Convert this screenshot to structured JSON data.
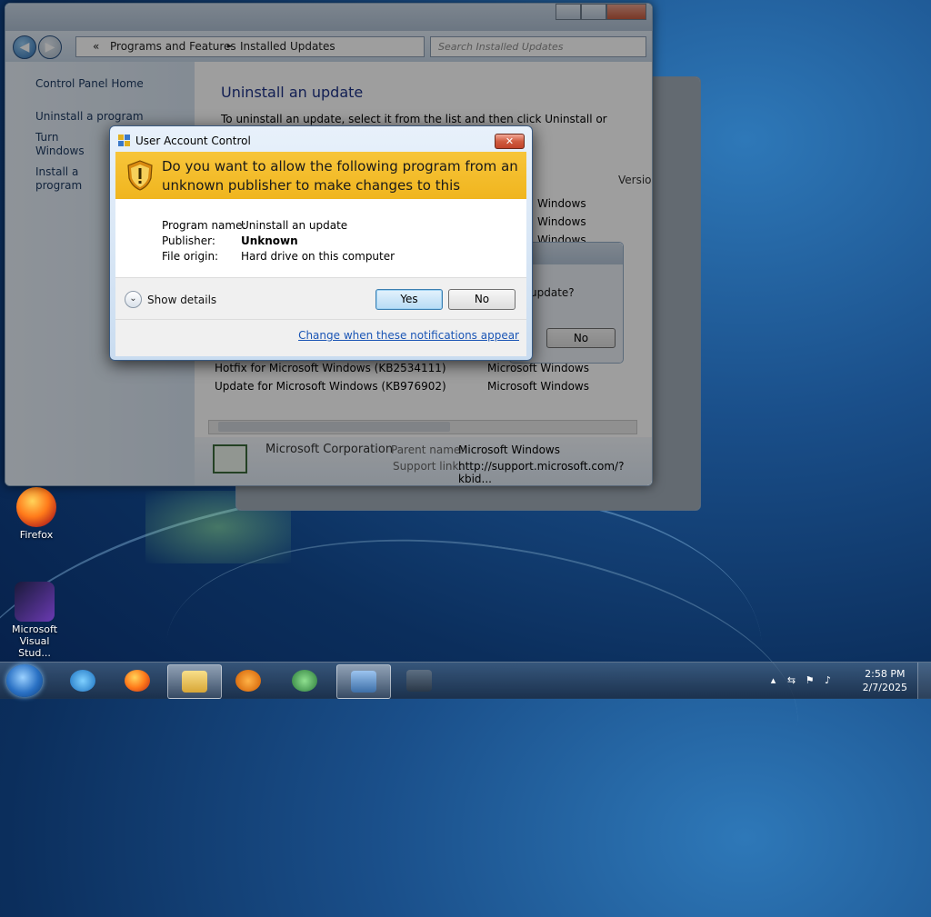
{
  "explorer": {
    "breadcrumb": [
      "«",
      "Programs and Features",
      "►",
      "Installed Updates"
    ],
    "search_placeholder": "Search Installed Updates",
    "left_links": [
      "Control Panel Home",
      "Uninstall a program",
      "Turn Windows features on or off",
      "Install a program from the network"
    ],
    "heading": "Uninstall an update",
    "description": "To uninstall an update, select it from the list and then click Uninstall or Change.",
    "column_version": "Versio",
    "rows": [
      {
        "name": "Hotfix for Microsoft Windows (KB2534111)",
        "program": "Microsoft Windows"
      },
      {
        "name": "Update for Microsoft Windows (KB976902)",
        "program": "Microsoft Windows"
      }
    ],
    "partial_programs": [
      "Windows",
      "Windows",
      "Windows"
    ],
    "details": {
      "publisher": "Microsoft Corporation",
      "parent_label": "Parent name:",
      "parent_value": "Microsoft Windows",
      "support_label": "Support link:",
      "support_value": "http://support.microsoft.com/?kbid..."
    }
  },
  "confirm_dialog": {
    "question": "update?",
    "no_label": "No"
  },
  "uac": {
    "title": "User Account Control",
    "close_glyph": "✕",
    "question": "Do you want to allow the following program from an unknown publisher to make changes to this computer?",
    "fields": [
      {
        "label": "Program name:",
        "value": "Uninstall an update"
      },
      {
        "label": "Publisher:",
        "value": "Unknown"
      },
      {
        "label": "File origin:",
        "value": "Hard drive on this computer"
      }
    ],
    "show_details": "Show details",
    "yes_label": "Yes",
    "no_label": "No",
    "notifications_link": "Change when these notifications appear",
    "accent": "#f0b51e"
  },
  "desktop_icons": [
    {
      "label": "Firefox"
    },
    {
      "label": "Microsoft Visual Stud..."
    }
  ],
  "taskbar": {
    "apps": [
      "internet-explorer",
      "firefox",
      "file-explorer",
      "media-player",
      "windows-media-center",
      "control-panel",
      "network"
    ],
    "time": "2:58 PM",
    "date": "2/7/2025"
  }
}
